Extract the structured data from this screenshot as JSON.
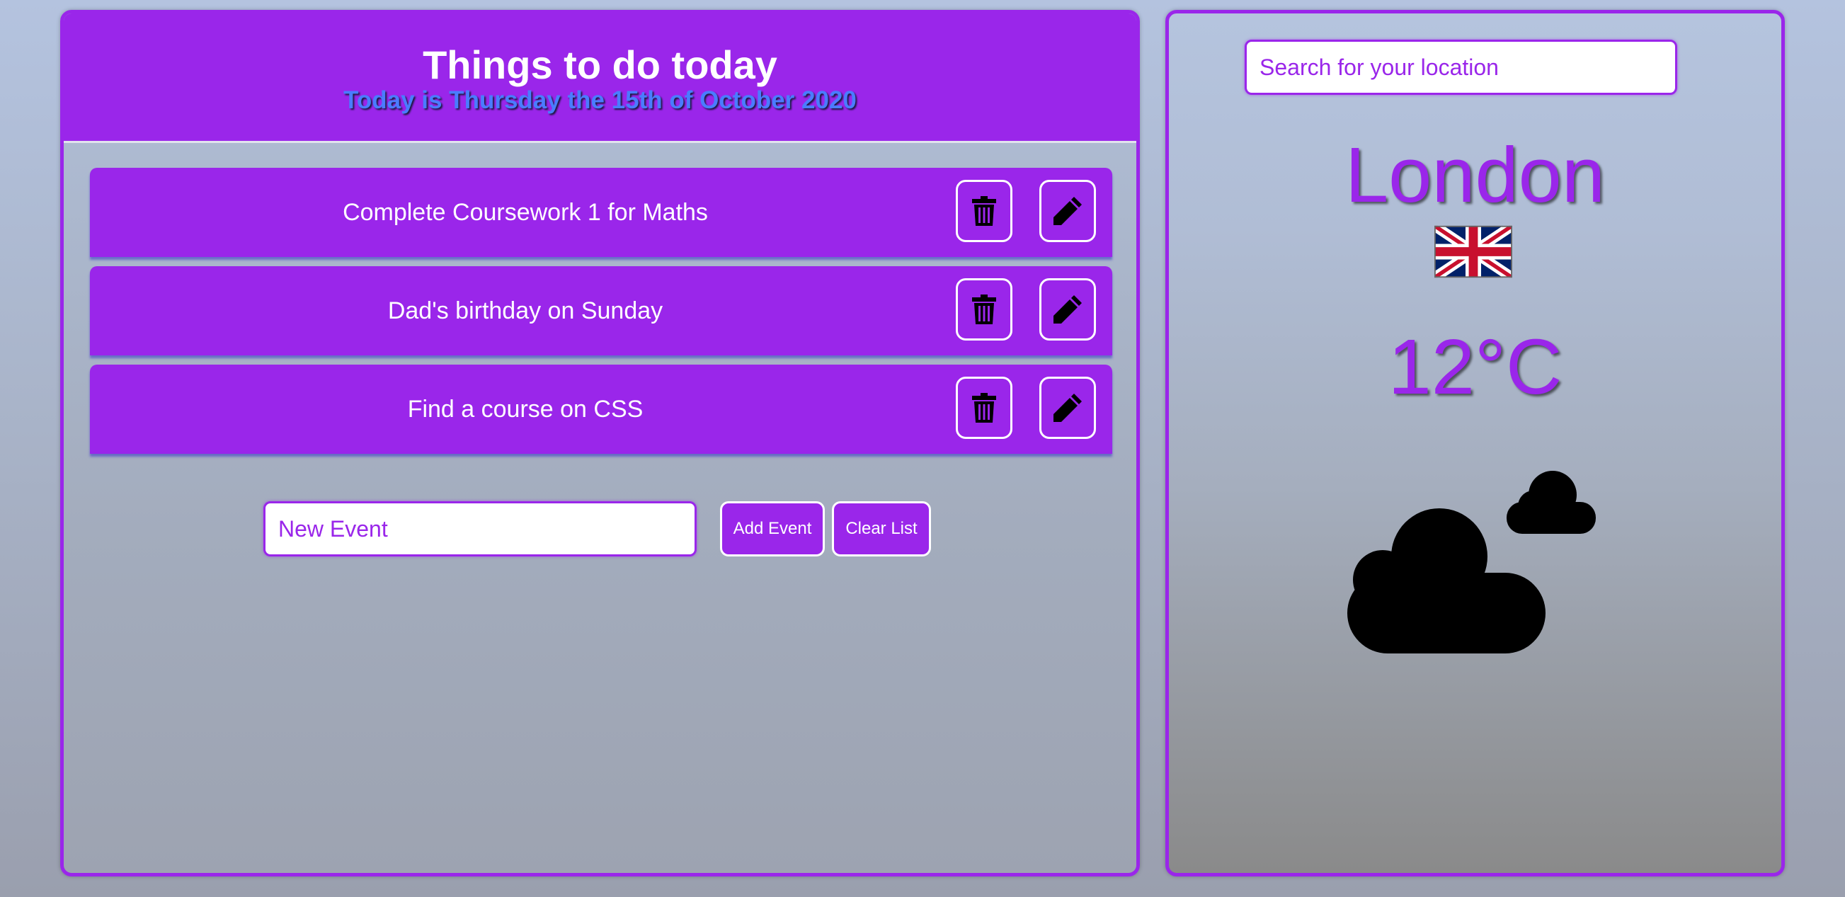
{
  "todo": {
    "title": "Things to do today",
    "date_line": "Today is Thursday the 15th of October 2020",
    "tasks": [
      {
        "text": "Complete Coursework 1 for Maths"
      },
      {
        "text": "Dad's birthday on Sunday"
      },
      {
        "text": "Find a course on CSS"
      }
    ],
    "task_actions": {
      "delete_icon": "trash-icon",
      "edit_icon": "pencil-icon"
    },
    "new_event_placeholder": "New Event",
    "add_label": "Add Event",
    "clear_label": "Clear List"
  },
  "weather": {
    "search_placeholder": "Search for your location",
    "city": "London",
    "flag_icon": "uk-flag-icon",
    "temperature": "12°C",
    "condition_icon": "cloudy-icon"
  },
  "colors": {
    "accent": "#9a26ea",
    "subtitle": "#4a7cff",
    "white": "#ffffff"
  }
}
